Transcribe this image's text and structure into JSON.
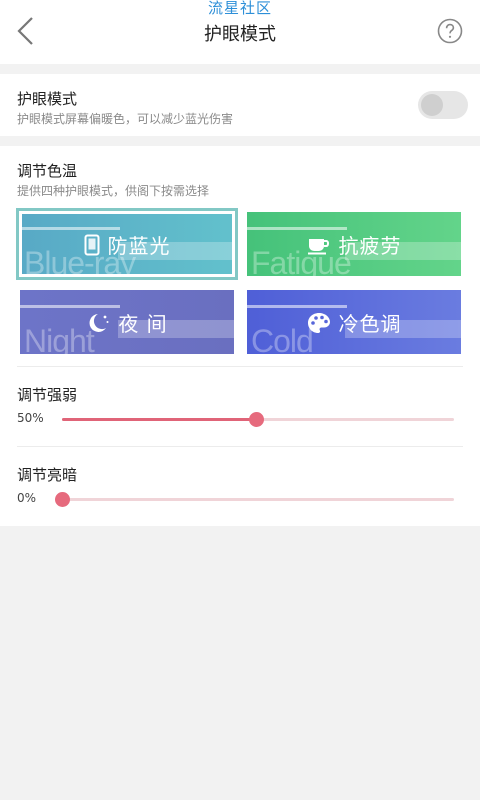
{
  "header": {
    "watermark": "流星社区",
    "title": "护眼模式"
  },
  "eye_mode": {
    "title": "护眼模式",
    "description": "护眼模式屏幕偏暖色，可以减少蓝光伤害",
    "enabled": false
  },
  "color_temp": {
    "title": "调节色温",
    "description": "提供四种护眼模式，供阁下按需选择",
    "selected": "blue-ray",
    "tiles": [
      {
        "id": "blue-ray",
        "label": "防蓝光",
        "ghost": "Blue-ray",
        "icon": "phone-icon",
        "color": "#5cb5c9"
      },
      {
        "id": "fatigue",
        "label": "抗疲劳",
        "ghost": "Fatigue",
        "icon": "coffee-cup-icon",
        "color": "#4cc980"
      },
      {
        "id": "night",
        "label": "夜 间",
        "ghost": "Night",
        "icon": "moon-stars-icon",
        "color": "#6c72c5"
      },
      {
        "id": "cold",
        "label": "冷色调",
        "ghost": "Cold",
        "icon": "palette-icon",
        "color": "#5766da"
      }
    ]
  },
  "intensity": {
    "title": "调节强弱",
    "value_text": "50%",
    "value": 50
  },
  "brightness": {
    "title": "调节亮暗",
    "value_text": "0%",
    "value": 0
  },
  "colors": {
    "accent": "#e06478",
    "selected_border": "#82c8c5"
  }
}
